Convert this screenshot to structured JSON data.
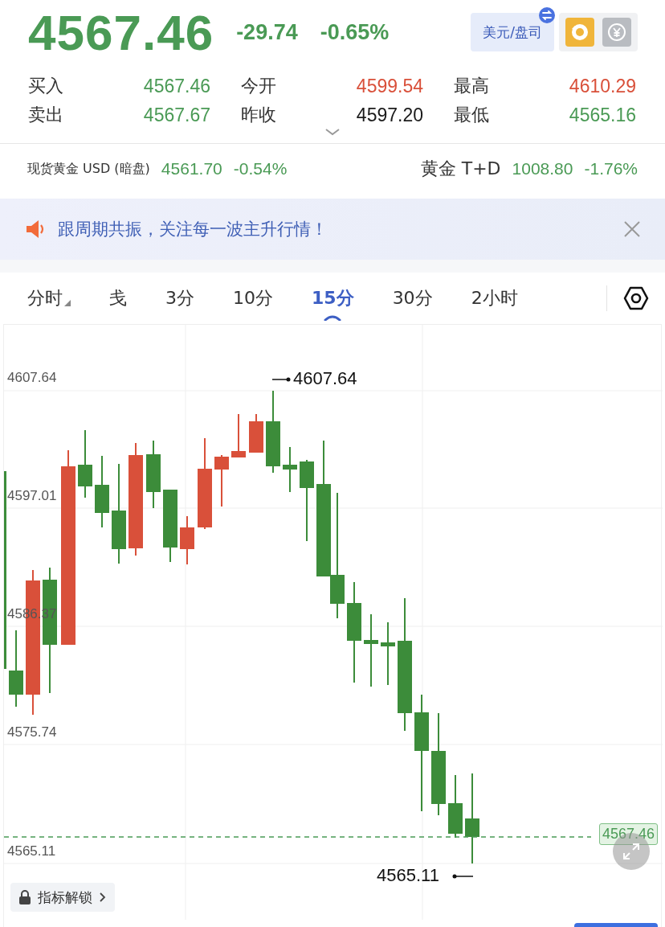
{
  "quote": {
    "price": "4567.46",
    "change": "-29.74",
    "change_pct": "-0.65%"
  },
  "unit_button": {
    "label": "美元/盘司"
  },
  "stats": [
    {
      "label": "买入",
      "value": "4567.46",
      "color": "#4a9a55"
    },
    {
      "label": "今开",
      "value": "4599.54",
      "color": "#d9503a"
    },
    {
      "label": "最高",
      "value": "4610.29",
      "color": "#d9503a"
    },
    {
      "label": "卖出",
      "value": "4567.67",
      "color": "#4a9a55"
    },
    {
      "label": "昨收",
      "value": "4597.20",
      "color": "#1a1a1a"
    },
    {
      "label": "最低",
      "value": "4565.16",
      "color": "#4a9a55"
    }
  ],
  "related": [
    {
      "kind": "small",
      "name": "现货黄金 USD (暗盘)",
      "price": "4561.70",
      "change": "-0.54%"
    },
    {
      "kind": "large",
      "name": "黄金 T+D",
      "price": "1008.80",
      "change": "-1.76%"
    }
  ],
  "banner": {
    "text": "跟周期共振，关注每一波主升行情！"
  },
  "tabs": [
    {
      "label": "分时",
      "selected": false,
      "dropdown": true
    },
    {
      "label": "戋",
      "selected": false,
      "dropdown": false
    },
    {
      "label": "3分",
      "selected": false,
      "dropdown": false
    },
    {
      "label": "10分",
      "selected": false,
      "dropdown": false
    },
    {
      "label": "15分",
      "selected": true,
      "dropdown": false
    },
    {
      "label": "30分",
      "selected": false,
      "dropdown": false
    },
    {
      "label": "2小时",
      "selected": false,
      "dropdown": false
    }
  ],
  "chart": {
    "y_labels": [
      "4607.64",
      "4597.01",
      "4586.37",
      "4575.74",
      "4565.11"
    ],
    "high_marker": "4607.64",
    "low_marker": "4565.11",
    "last_price": "4567.46"
  },
  "lock_button": {
    "label": "指标解锁"
  }
}
